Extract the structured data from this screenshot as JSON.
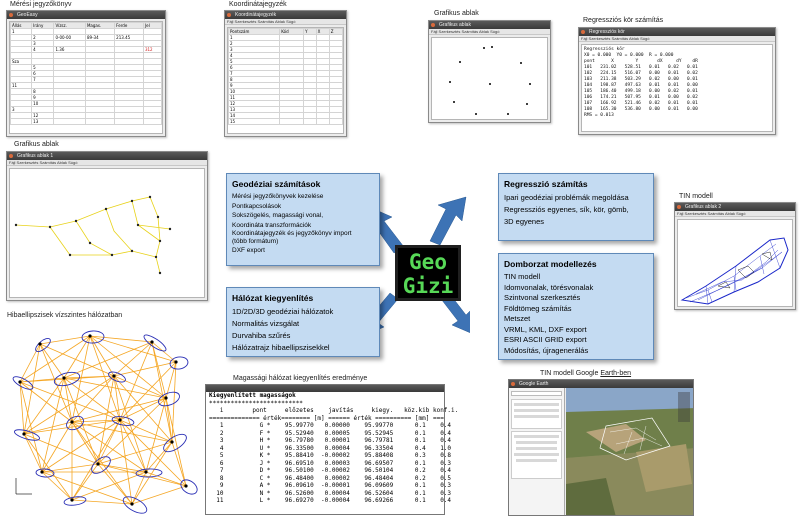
{
  "captions": {
    "meresi": "Mérési jegyzőkönyv",
    "koord": "Koordinátajegyzék",
    "grafikus_top": "Grafikus ablak",
    "regresszio_kor": "Regressziós kör számítás",
    "grafikus_left": "Grafikus ablak",
    "tin": "TIN modell",
    "hiba": "Hibaellipszisek vízszintes hálózatban",
    "magassagi": "Magassági hálózat kiegyenlítés eredménye",
    "tin_google_prefix": "TIN modell Google ",
    "tin_google_link": "Earth-ben"
  },
  "windows": {
    "meresi_title": "GeoEasy",
    "koord_title": "Koordinátajegyzék",
    "grafikus_top_title": "Grafikus ablak",
    "regresszio_title": "Regressziós kör",
    "grafikus_left_title": "Grafikus ablak 1",
    "tin_title": "Grafikus ablak 2",
    "ge_title": "Google Earth",
    "menu": "Fájl  Szerkesztés  Számítás  Ablak  Súgó"
  },
  "geodeziai": {
    "title": "Geodéziai számítások",
    "items": [
      "Mérési jegyzőkönyvek kezelése",
      "Pontkapcsolások",
      "Sokszögelés, magassági vonal,",
      "Koordináta transzformációk",
      "Koordinátajegyzék és jegyzőkönyv import",
      "(több formátum)",
      "DXF export"
    ]
  },
  "halozat": {
    "title": "Hálózat kiegyenlítés",
    "items": [
      "1D/2D/3D geodéziai hálózatok",
      "Normalitás vizsgálat",
      "Durvahiba szűrés",
      "Hálózatrajz hibaellipszisekkel"
    ]
  },
  "regresszio": {
    "title": "Regresszió számítás",
    "items": [
      "Ipari geodéziai problémák megoldása",
      "Regressziós egyenes, sík, kör, gömb,",
      "3D egyenes"
    ]
  },
  "domborzat": {
    "title": "Domborzat modellezés",
    "items": [
      "TIN modell",
      "Idomvonalak, törésvonalak",
      "Szintvonal  szerkesztés",
      "Földtömeg számítás",
      "Metszet",
      "VRML, KML, DXF export",
      "ESRI ASCII GRID export",
      "Módosítás, újragenerálás"
    ]
  },
  "logo": {
    "line1": "Geo",
    "line2": "Gizi"
  },
  "kiegyenlitett": {
    "title": "Kiegyenlített magasságok",
    "stars": "**************************",
    "header1": "   i        pont     előzetes    javítás     kiegy.   köz.kib konf.i.",
    "header2": "============== érték======== [m] ====== érték ========== [mm] ===",
    "rows": [
      "   1          G *    95.99770   0.00000    95.99770      0.1    0.4",
      "   2          F *    95.52940   0.00005    95.52945      0.1    0.4",
      "   3          H *    96.79780   0.00001    96.79781      0.1    0.4",
      "   4          U *    96.33500   0.00004    96.33504      0.4    1.0",
      "   5          K *    95.88410  -0.00002    95.88408      0.3    0.8",
      "   6          J *    96.69510   0.00003    96.69507      0.1    0.3",
      "   7          D *    96.50100  -0.00002    96.50104      0.2    0.4",
      "   8          C *    96.48400   0.00002    96.48404      0.2    0.5",
      "   9          A *    96.09610  -0.00001    96.09609      0.1    0.3",
      "  10          N *    96.52600   0.00004    96.52604      0.1    0.3",
      "  11          L *    96.69270  -0.00004    96.69266      0.1    0.4"
    ]
  },
  "regresszio_lines": [
    "Regressziós kör",
    "X0 = 0.000  Y0 = 0.000  R = 0.000",
    "",
    "pont      X        Y       dX     dY    dR",
    "101   231.02   528.51   0.01   0.02   0.01",
    "102   224.15   516.07   0.00   0.01   0.02",
    "103   211.38   503.29   0.02   0.00   0.01",
    "104   198.87   497.63   0.01   0.01   0.00",
    "105   186.40   499.18   0.00   0.02   0.01",
    "106   174.21   507.95   0.01   0.00   0.02",
    "107   166.92   521.46   0.02   0.01   0.01",
    "108   165.30   536.80   0.00   0.01   0.00",
    "",
    "RMS = 0.013"
  ],
  "meresi_rows": [
    [
      "Állás",
      "Irány",
      "Vízsz.",
      "Magas.",
      "Ferde",
      "Jel"
    ],
    [
      "1",
      "",
      "",
      "",
      "",
      ""
    ],
    [
      "",
      "2",
      "0-00-00",
      "89-34",
      "213.45",
      ""
    ],
    [
      "",
      "3",
      "",
      "",
      "",
      ""
    ],
    [
      "",
      "4",
      "1.36",
      "",
      "",
      "312"
    ],
    [
      "",
      "",
      "",
      "",
      "",
      ""
    ],
    [
      "Sza",
      "",
      "",
      "",
      "",
      ""
    ],
    [
      "",
      "5",
      "",
      "",
      "",
      ""
    ],
    [
      "",
      "6",
      "",
      "",
      "",
      ""
    ],
    [
      "",
      "7",
      "",
      "",
      "",
      ""
    ],
    [
      "11",
      "",
      "",
      "",
      "",
      ""
    ],
    [
      "",
      "8",
      "",
      "",
      "",
      ""
    ],
    [
      "",
      "9",
      "",
      "",
      "",
      ""
    ],
    [
      "",
      "10",
      "",
      "",
      "",
      ""
    ],
    [
      "3",
      "",
      "",
      "",
      "",
      ""
    ],
    [
      "",
      "12",
      "",
      "",
      "",
      ""
    ],
    [
      "",
      "13",
      "",
      "",
      "",
      ""
    ]
  ],
  "koord_rows": [
    [
      "Pontszám",
      "Kód",
      "Y",
      "X",
      "Z"
    ],
    [
      "1",
      "",
      "",
      "",
      ""
    ],
    [
      "2",
      "",
      "",
      "",
      ""
    ],
    [
      "3",
      "",
      "",
      "",
      ""
    ],
    [
      "4",
      "",
      "",
      "",
      ""
    ],
    [
      "5",
      "",
      "",
      "",
      ""
    ],
    [
      "6",
      "",
      "",
      "",
      ""
    ],
    [
      "7",
      "",
      "",
      "",
      ""
    ],
    [
      "8",
      "",
      "",
      "",
      ""
    ],
    [
      "9",
      "",
      "",
      "",
      ""
    ],
    [
      "10",
      "",
      "",
      "",
      ""
    ],
    [
      "11",
      "",
      "",
      "",
      ""
    ],
    [
      "12",
      "",
      "",
      "",
      ""
    ],
    [
      "13",
      "",
      "",
      "",
      ""
    ],
    [
      "14",
      "",
      "",
      "",
      ""
    ],
    [
      "15",
      "",
      "",
      "",
      ""
    ]
  ],
  "colors": {
    "panel_fill": "#c4dbf2",
    "panel_border": "#5f89b8",
    "arrow": "#3d73b5",
    "logo_text": "#57d957",
    "network_line": "#f5a623",
    "ellipse": "#2a2fb5",
    "red_value": "#d01c1c"
  }
}
